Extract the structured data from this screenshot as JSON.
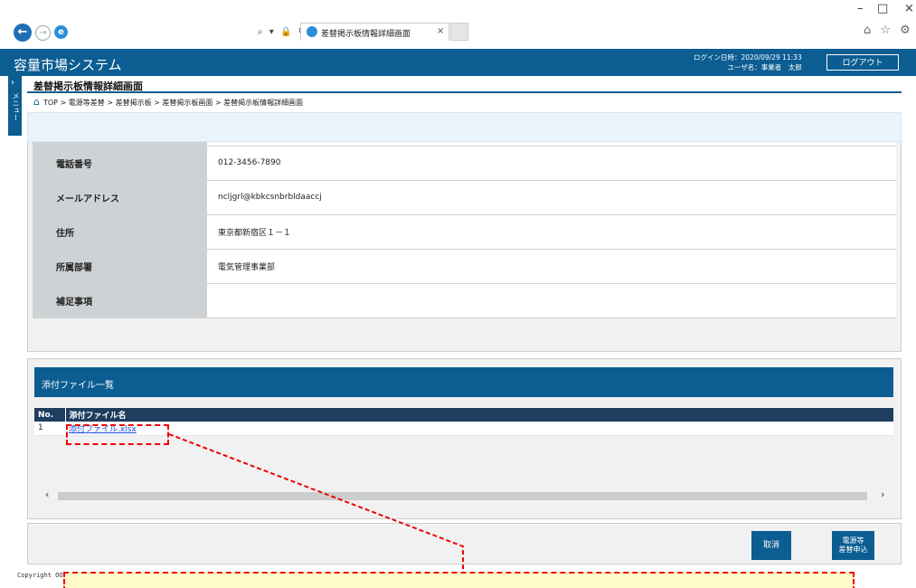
{
  "browser": {
    "tab_title": "差替掲示板情報詳細画面",
    "tab_close": "×",
    "minimize": "–",
    "maximize": "□",
    "close": "×",
    "address_tools": "⌕ ▾ 🔒 ↻",
    "fav_icons": "⌂ ☆ ⚙"
  },
  "header": {
    "app_title": "容量市場システム",
    "login_time": "ログイン日時：2020/09/29 11:33",
    "user_name": "ユーザ名：事業者　太郎",
    "logout_label": "ログアウト"
  },
  "side_menu": {
    "label": "メニュー"
  },
  "page": {
    "title": "差替掲示板情報詳細画面",
    "breadcrumb": "TOP > 電源等差替 > 差替掲示板 > 差替掲示板画面 > 差替掲示板情報詳細画面"
  },
  "details": [
    {
      "label": "電話番号",
      "value": "012-3456-7890"
    },
    {
      "label": "メールアドレス",
      "value": "ncljgrl@kbkcsnbrbldaaccj"
    },
    {
      "label": "住所",
      "value": "東京都新宿区１－１"
    },
    {
      "label": "所属部署",
      "value": "電気管理事業部"
    },
    {
      "label": "補足事項",
      "value": ""
    }
  ],
  "attachments": {
    "section_title": "添付ファイル一覧",
    "col_no": "No.",
    "col_name": "添付ファイル名",
    "rows": [
      {
        "no": "1",
        "name": "添付ファイル.xlsx"
      }
    ]
  },
  "actions": {
    "cancel_label": "取消",
    "apply_line1": "電源等",
    "apply_line2": "差替申込"
  },
  "footer": {
    "copyright": "Copyright OO"
  },
  "colors": {
    "primary": "#0b5d92",
    "table_header": "#1f3d5e",
    "annotation": "#e00000",
    "callout_bg": "#fffbc8"
  }
}
